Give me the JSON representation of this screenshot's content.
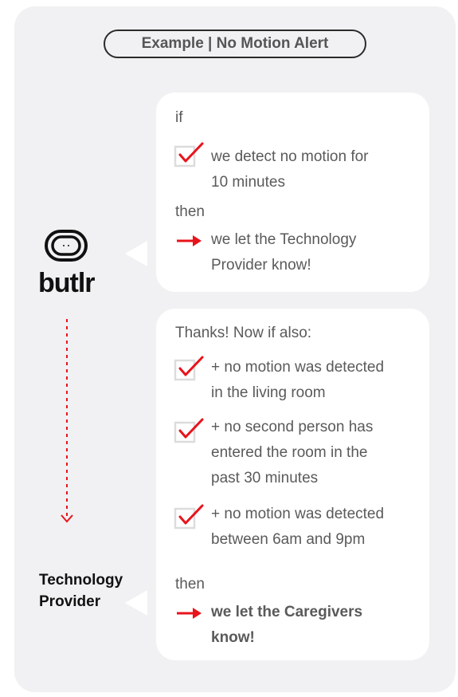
{
  "title": "Example | No Motion Alert",
  "brand": "butlr",
  "provider_label": "Technology Provider",
  "colors": {
    "accent": "#e8141b",
    "panel": "#f1f1f3",
    "card": "#ffffff",
    "outline": "#2b2b2b"
  },
  "icons": {
    "check": "check-icon",
    "arrow": "arrow-right-icon",
    "logo": "butlr-logo-icon",
    "down": "arrow-down-icon"
  },
  "card1": {
    "if_label": "if",
    "condition_line1": "we detect no motion for",
    "condition_line2": "10 minutes",
    "then_label": "then",
    "action_line1": "we let the Technology",
    "action_line2": "Provider know!"
  },
  "card2": {
    "intro": "Thanks! Now if also:",
    "cond1_line1": "+ no motion was detected",
    "cond1_line2": "in the living room",
    "cond2_line1": "+ no second person has",
    "cond2_line2": "entered the room in the",
    "cond2_line3": "past 30 minutes",
    "cond3_line1": "+ no motion was detected",
    "cond3_line2": "between 6am and 9pm",
    "then_label": "then",
    "action_line1": "we let the Caregivers",
    "action_line2": "know!"
  }
}
